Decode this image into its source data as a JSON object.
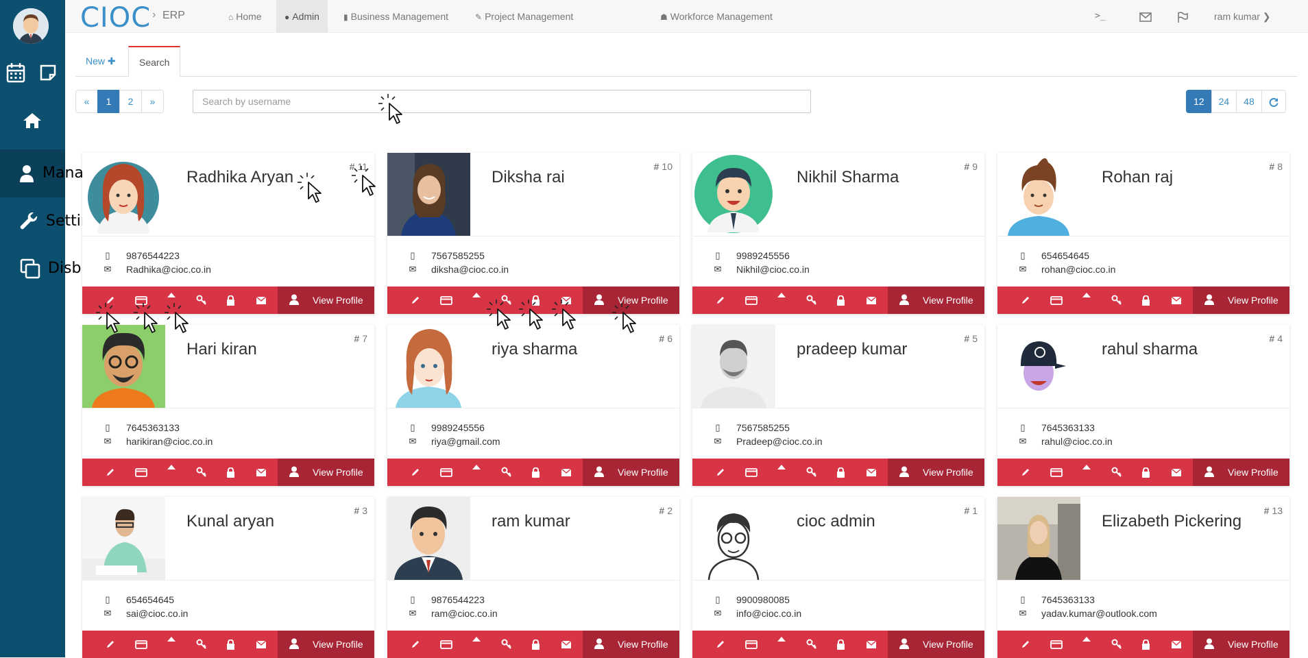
{
  "brand": {
    "logo": "CIOC",
    "sep": "›",
    "app": "ERP"
  },
  "nav": [
    {
      "label": "Home",
      "icon": "home-icon"
    },
    {
      "label": "Admin",
      "icon": "user-icon"
    },
    {
      "label": "Business Management",
      "icon": "bar-chart-icon"
    },
    {
      "label": "Project Management",
      "icon": "wrench-icon"
    },
    {
      "label": "Workforce Management",
      "icon": "users-icon"
    }
  ],
  "nav_right": {
    "terminal": ">_",
    "user": "ram kumar ❯"
  },
  "sidebar": {
    "items": [
      {
        "label": "Manage Users",
        "icon": "user-icon"
      },
      {
        "label": "Setting",
        "icon": "wrench-icon"
      },
      {
        "label": "Disbursal",
        "icon": "copy-icon"
      }
    ]
  },
  "tabs": {
    "new": "New ✚",
    "search": "Search"
  },
  "pager": {
    "prev": "«",
    "pages": [
      "1",
      "2"
    ],
    "next": "»"
  },
  "page_size": [
    "12",
    "24",
    "48"
  ],
  "search": {
    "placeholder": "Search by username",
    "value": ""
  },
  "actions": {
    "view_profile": "View Profile"
  },
  "users": [
    {
      "name": "Radhika Aryan",
      "id": "11",
      "phone": "9876544223",
      "email": "Radhika@cioc.co.in"
    },
    {
      "name": "Diksha rai",
      "id": "10",
      "phone": "7567585255",
      "email": "diksha@cioc.co.in"
    },
    {
      "name": "Nikhil Sharma",
      "id": "9",
      "phone": "9989245556",
      "email": "Nikhil@cioc.co.in"
    },
    {
      "name": "Rohan raj",
      "id": "8",
      "phone": "654654645",
      "email": "rohan@cioc.co.in"
    },
    {
      "name": "Hari kiran",
      "id": "7",
      "phone": "7645363133",
      "email": "harikiran@cioc.co.in"
    },
    {
      "name": "riya sharma",
      "id": "6",
      "phone": "9989245556",
      "email": "riya@gmail.com"
    },
    {
      "name": "pradeep kumar",
      "id": "5",
      "phone": "7567585255",
      "email": "Pradeep@cioc.co.in"
    },
    {
      "name": "rahul sharma",
      "id": "4",
      "phone": "7645363133",
      "email": "rahul@cioc.co.in"
    },
    {
      "name": "Kunal aryan",
      "id": "3",
      "phone": "654654645",
      "email": "sai@cioc.co.in"
    },
    {
      "name": "ram kumar",
      "id": "2",
      "phone": "9876544223",
      "email": "ram@cioc.co.in"
    },
    {
      "name": "cioc admin",
      "id": "1",
      "phone": "9900980085",
      "email": "info@cioc.co.in"
    },
    {
      "name": "Elizabeth Pickering",
      "id": "13",
      "phone": "7645363133",
      "email": "yadav.kumar@outlook.com"
    }
  ],
  "colors": {
    "sidebar": "#0d4f6e",
    "action_bar": "#d73445",
    "view_btn": "#a82535",
    "link": "#3a8fc9"
  }
}
